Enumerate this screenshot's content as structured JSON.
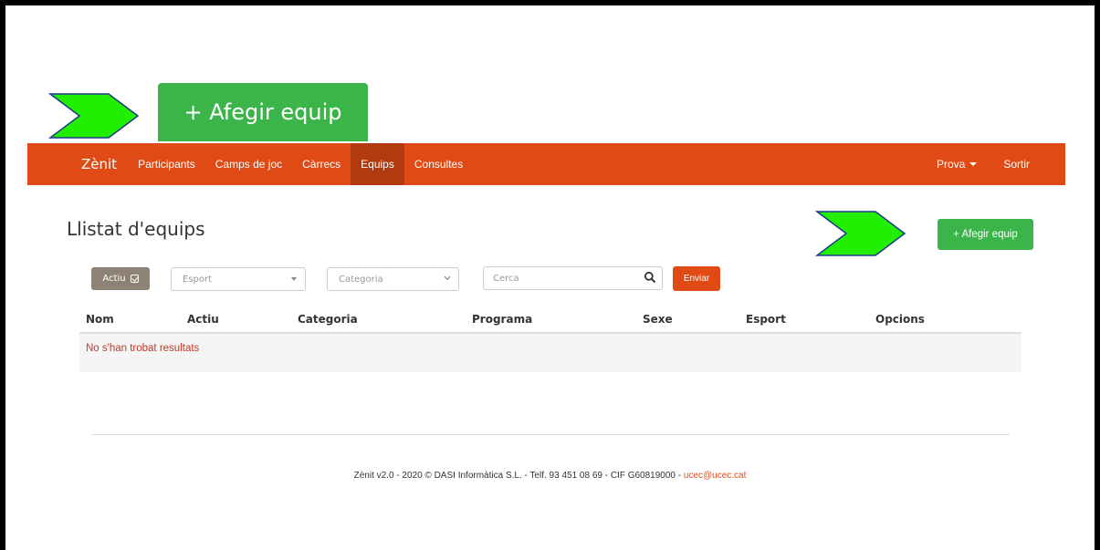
{
  "callout": {
    "button_label": "+ Afegir equip"
  },
  "navbar": {
    "brand": "Zènit",
    "items": [
      "Participants",
      "Camps de joc",
      "Càrrecs",
      "Equips",
      "Consultes"
    ],
    "active": "Equips",
    "user_menu": "Prova",
    "logout": "Sortir"
  },
  "page": {
    "title": "Llistat d'equips",
    "add_button": "+ Afegir equip"
  },
  "filters": {
    "actiu_label": "Actiu",
    "esport_placeholder": "Esport",
    "categoria_placeholder": "Categoria",
    "search_placeholder": "Cerca",
    "send_label": "Enviar"
  },
  "table": {
    "columns": [
      "Nom",
      "Actiu",
      "Categoria",
      "Programa",
      "Sexe",
      "Esport",
      "Opcions"
    ],
    "empty_message": "No s'han trobat resultats"
  },
  "footer": {
    "text": "Zènit v2.0 - 2020 © DASI Informàtica S.L. - Telf. 93 451 08 69 - CIF G60819000 - ",
    "email": "ucec@ucec.cat"
  },
  "colors": {
    "primary": "#e04a15",
    "active_nav": "#b23a0e",
    "success": "#3bb54a",
    "callout_arrow": "#22ee00",
    "filter_gray": "#8e8276"
  }
}
